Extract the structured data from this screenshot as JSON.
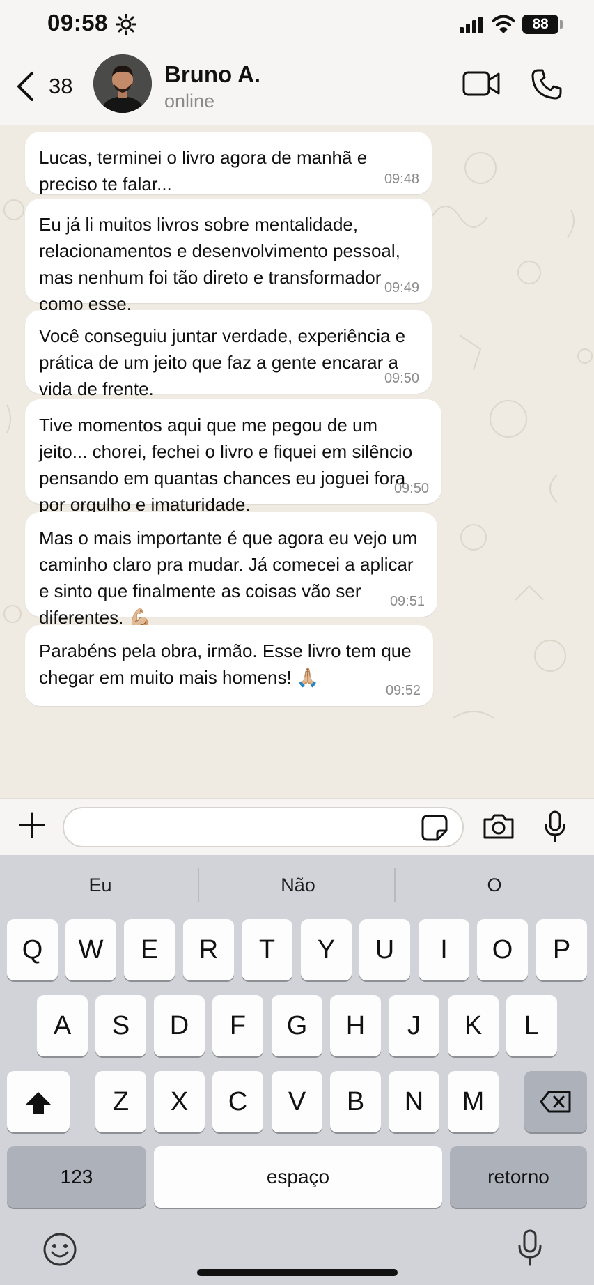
{
  "status_bar": {
    "time": "09:58",
    "battery": "88"
  },
  "header": {
    "back_count": "38",
    "contact_name": "Bruno A.",
    "contact_status": "online"
  },
  "messages": [
    {
      "text": "Lucas, terminei o livro agora de manhã e preciso te falar...",
      "time": "09:48"
    },
    {
      "text": "Eu já li muitos livros sobre mentalidade, relacionamentos e desenvolvimento pessoal, mas nenhum foi tão direto e transformador como esse.",
      "time": "09:49"
    },
    {
      "text": "Você conseguiu juntar verdade, experiência e prática de um jeito que faz a gente encarar a vida de frente.",
      "time": "09:50"
    },
    {
      "text": "Tive momentos aqui que me pegou de um jeito... chorei, fechei o livro e fiquei em silêncio pensando em quantas chances eu joguei fora por orgulho e imaturidade.",
      "time": "09:50"
    },
    {
      "text": "Mas o mais importante é que agora eu vejo um caminho claro pra mudar. Já comecei a aplicar e sinto que finalmente as coisas vão ser diferentes. 💪🏼",
      "time": "09:51"
    },
    {
      "text": "Parabéns pela obra, irmão. Esse livro tem que chegar em muito mais homens! 🙏🏼",
      "time": "09:52"
    }
  ],
  "composer": {
    "value": "",
    "placeholder": ""
  },
  "keyboard": {
    "suggestions": [
      "Eu",
      "Não",
      "O"
    ],
    "row1": [
      "Q",
      "W",
      "E",
      "R",
      "T",
      "Y",
      "U",
      "I",
      "O",
      "P"
    ],
    "row2": [
      "A",
      "S",
      "D",
      "F",
      "G",
      "H",
      "J",
      "K",
      "L"
    ],
    "row3": [
      "Z",
      "X",
      "C",
      "V",
      "B",
      "N",
      "M"
    ],
    "numbers_label": "123",
    "space_label": "espaço",
    "return_label": "retorno"
  },
  "colors": {
    "chat_background": "#efeae2",
    "bubble": "#ffffff",
    "keyboard": "#d1d3d9",
    "header": "#f6f5f3"
  },
  "icons": [
    "sun-icon",
    "signal-icon",
    "wifi-icon",
    "back-chevron-icon",
    "video-call-icon",
    "phone-call-icon",
    "plus-icon",
    "sticker-icon",
    "camera-icon",
    "mic-icon",
    "shift-icon",
    "backspace-icon",
    "emoji-icon",
    "dictation-icon"
  ]
}
